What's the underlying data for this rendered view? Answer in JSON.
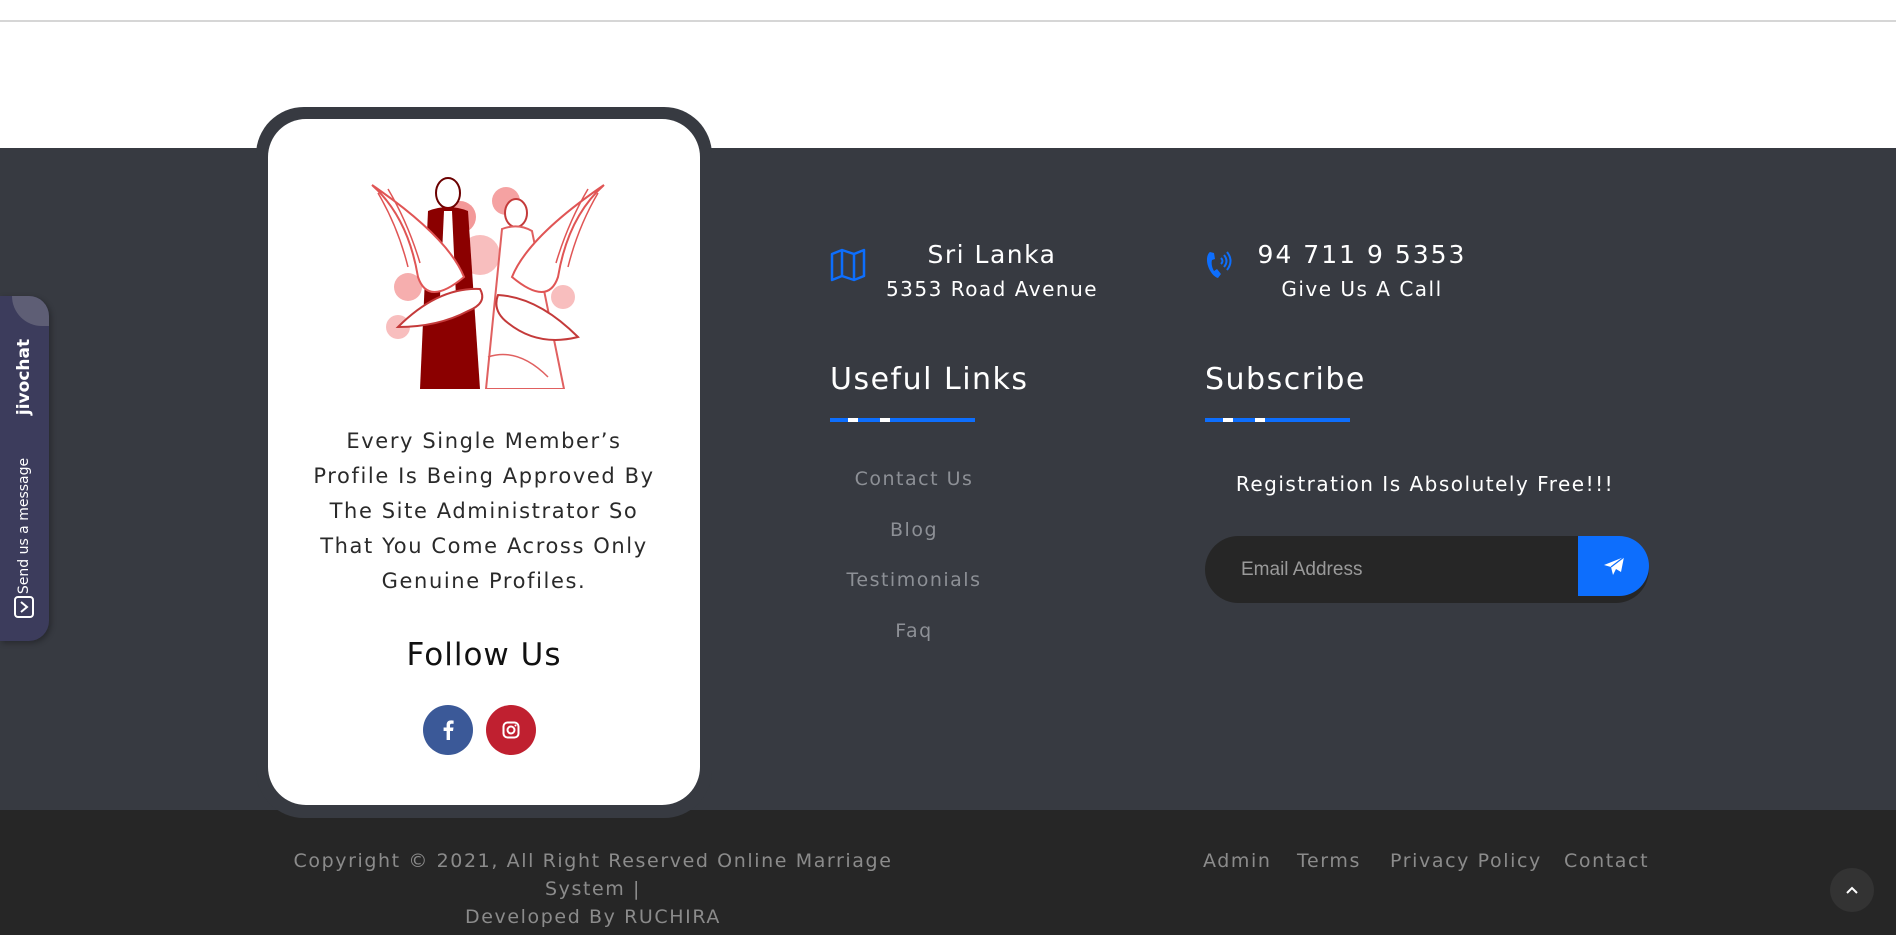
{
  "card": {
    "description": "Every Single Member’s Profile Is Being Approved By The Site Administrator So That You Come Across Only Genuine Profiles.",
    "follow_title": "Follow Us",
    "colors": {
      "facebook": "#3b5998",
      "instagram": "#c02030"
    },
    "icons": [
      "wedding-couple-doves-logo",
      "facebook-icon",
      "instagram-icon"
    ]
  },
  "chat_widget": {
    "brand": "jivochat",
    "message": "Send us a message",
    "color": "#3c3c5c"
  },
  "contact": {
    "location_title": "Sri Lanka",
    "location_sub": "5353 Road Avenue",
    "phone_title": "94 711 9 5353",
    "phone_sub": "Give Us A Call",
    "icons": [
      "map-icon",
      "phone-icon"
    ]
  },
  "useful_links": {
    "title": "Useful Links",
    "items": [
      "Contact Us",
      "Blog",
      "Testimonials",
      "Faq"
    ]
  },
  "subscribe": {
    "title": "Subscribe",
    "tagline": "Registration Is Absolutely Free!!!",
    "email_placeholder": "Email Address",
    "send_icon": "paper-plane-icon",
    "accent": "#0d6efd"
  },
  "bottom": {
    "copyright_line1": "Copyright © 2021, All Right Reserved Online Marriage System |",
    "copyright_line2": "Developed By RUCHIRA",
    "links": [
      "Admin",
      "Terms",
      "Privacy Policy",
      "Contact"
    ],
    "to_top_icon": "chevron-up-icon"
  },
  "colors": {
    "footer_bg": "#373a41",
    "bottom_bg": "#262626",
    "accent": "#0d6efd"
  }
}
